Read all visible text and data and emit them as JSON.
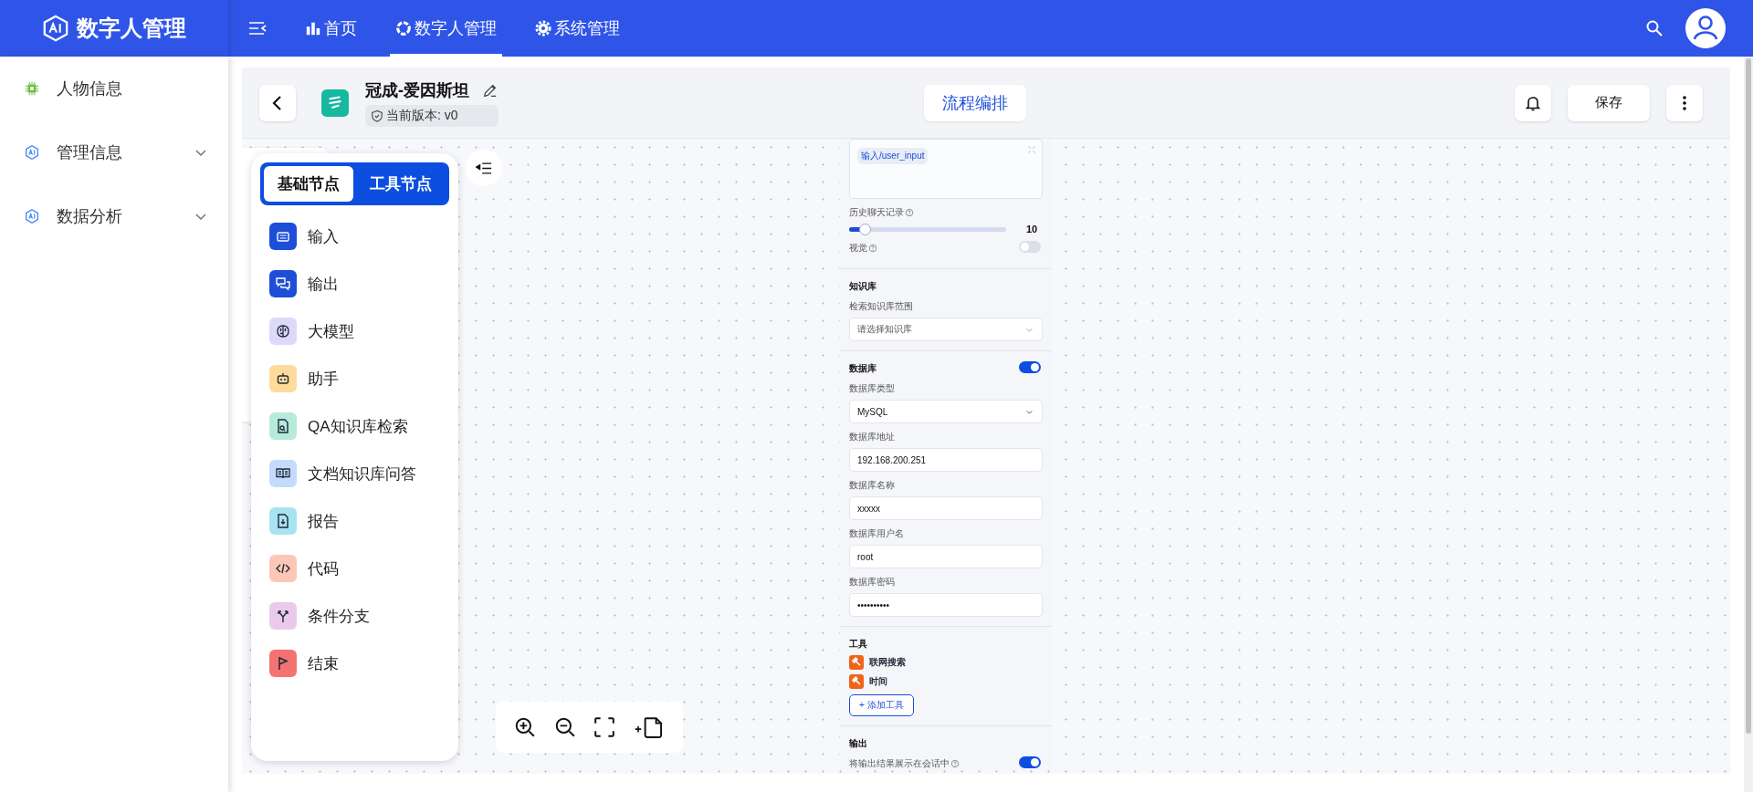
{
  "app": {
    "title": "数字人管理"
  },
  "top_nav": [
    {
      "label": "首页",
      "kind": "chart",
      "selected": false
    },
    {
      "label": "数字人管理",
      "kind": "aperture",
      "selected": true
    },
    {
      "label": "系统管理",
      "kind": "gear",
      "selected": false
    }
  ],
  "sidebar": {
    "items": [
      {
        "label": "人物信息",
        "kind": "chip",
        "expandable": false
      },
      {
        "label": "管理信息",
        "kind": "ai",
        "expandable": true
      },
      {
        "label": "数据分析",
        "kind": "ai",
        "expandable": true
      }
    ]
  },
  "header": {
    "title": "冠成-爱因斯坦",
    "version": "当前版本: v0",
    "center_button": "流程编排",
    "save_button": "保存"
  },
  "node_panel": {
    "tabs": [
      {
        "label": "基础节点",
        "selected": true
      },
      {
        "label": "工具节点",
        "selected": false
      }
    ],
    "items": [
      {
        "label": "输入",
        "kind": "keyboard",
        "color": "#1d4ed8"
      },
      {
        "label": "输出",
        "kind": "chat",
        "color": "#1d4ed8"
      },
      {
        "label": "大模型",
        "kind": "brain",
        "color": "#dcd9fb"
      },
      {
        "label": "助手",
        "kind": "robot",
        "color": "#fddb9a"
      },
      {
        "label": "QA知识库检索",
        "kind": "docsearch",
        "color": "#b6ebdb"
      },
      {
        "label": "文档知识库问答",
        "kind": "book",
        "color": "#c3dcfb"
      },
      {
        "label": "报告",
        "kind": "download",
        "color": "#a8e3f1"
      },
      {
        "label": "代码",
        "kind": "code",
        "color": "#fdc7b8"
      },
      {
        "label": "条件分支",
        "kind": "branch",
        "color": "#ebc9eb"
      },
      {
        "label": "结束",
        "kind": "flag",
        "color": "#f47272"
      }
    ]
  },
  "properties": {
    "prompt_tag": "输入/user_input",
    "history": {
      "label": "历史聊天记录",
      "level": 0.1,
      "reading": "10"
    },
    "vision": {
      "label": "视觉",
      "on": false
    },
    "knowledge": {
      "title": "知识库",
      "label": "检索知识库范围",
      "placeholder": "请选择知识库"
    },
    "database": {
      "title": "数据库",
      "on": true,
      "fields": [
        {
          "label": "数据库类型",
          "kind": "select",
          "value": "MySQL"
        },
        {
          "label": "数据库地址",
          "kind": "text",
          "value": "192.168.200.251"
        },
        {
          "label": "数据库名称",
          "kind": "text",
          "value": "xxxxx"
        },
        {
          "label": "数据库用户名",
          "kind": "text",
          "value": "root"
        },
        {
          "label": "数据库密码",
          "kind": "text",
          "value": "••••••••••"
        }
      ]
    },
    "tools": {
      "title": "工具",
      "items": [
        "联网搜索",
        "时间"
      ],
      "add_button": "+ 添加工具"
    },
    "output": {
      "title": "输出",
      "label": "将输出结果展示在会话中",
      "on": true
    }
  }
}
